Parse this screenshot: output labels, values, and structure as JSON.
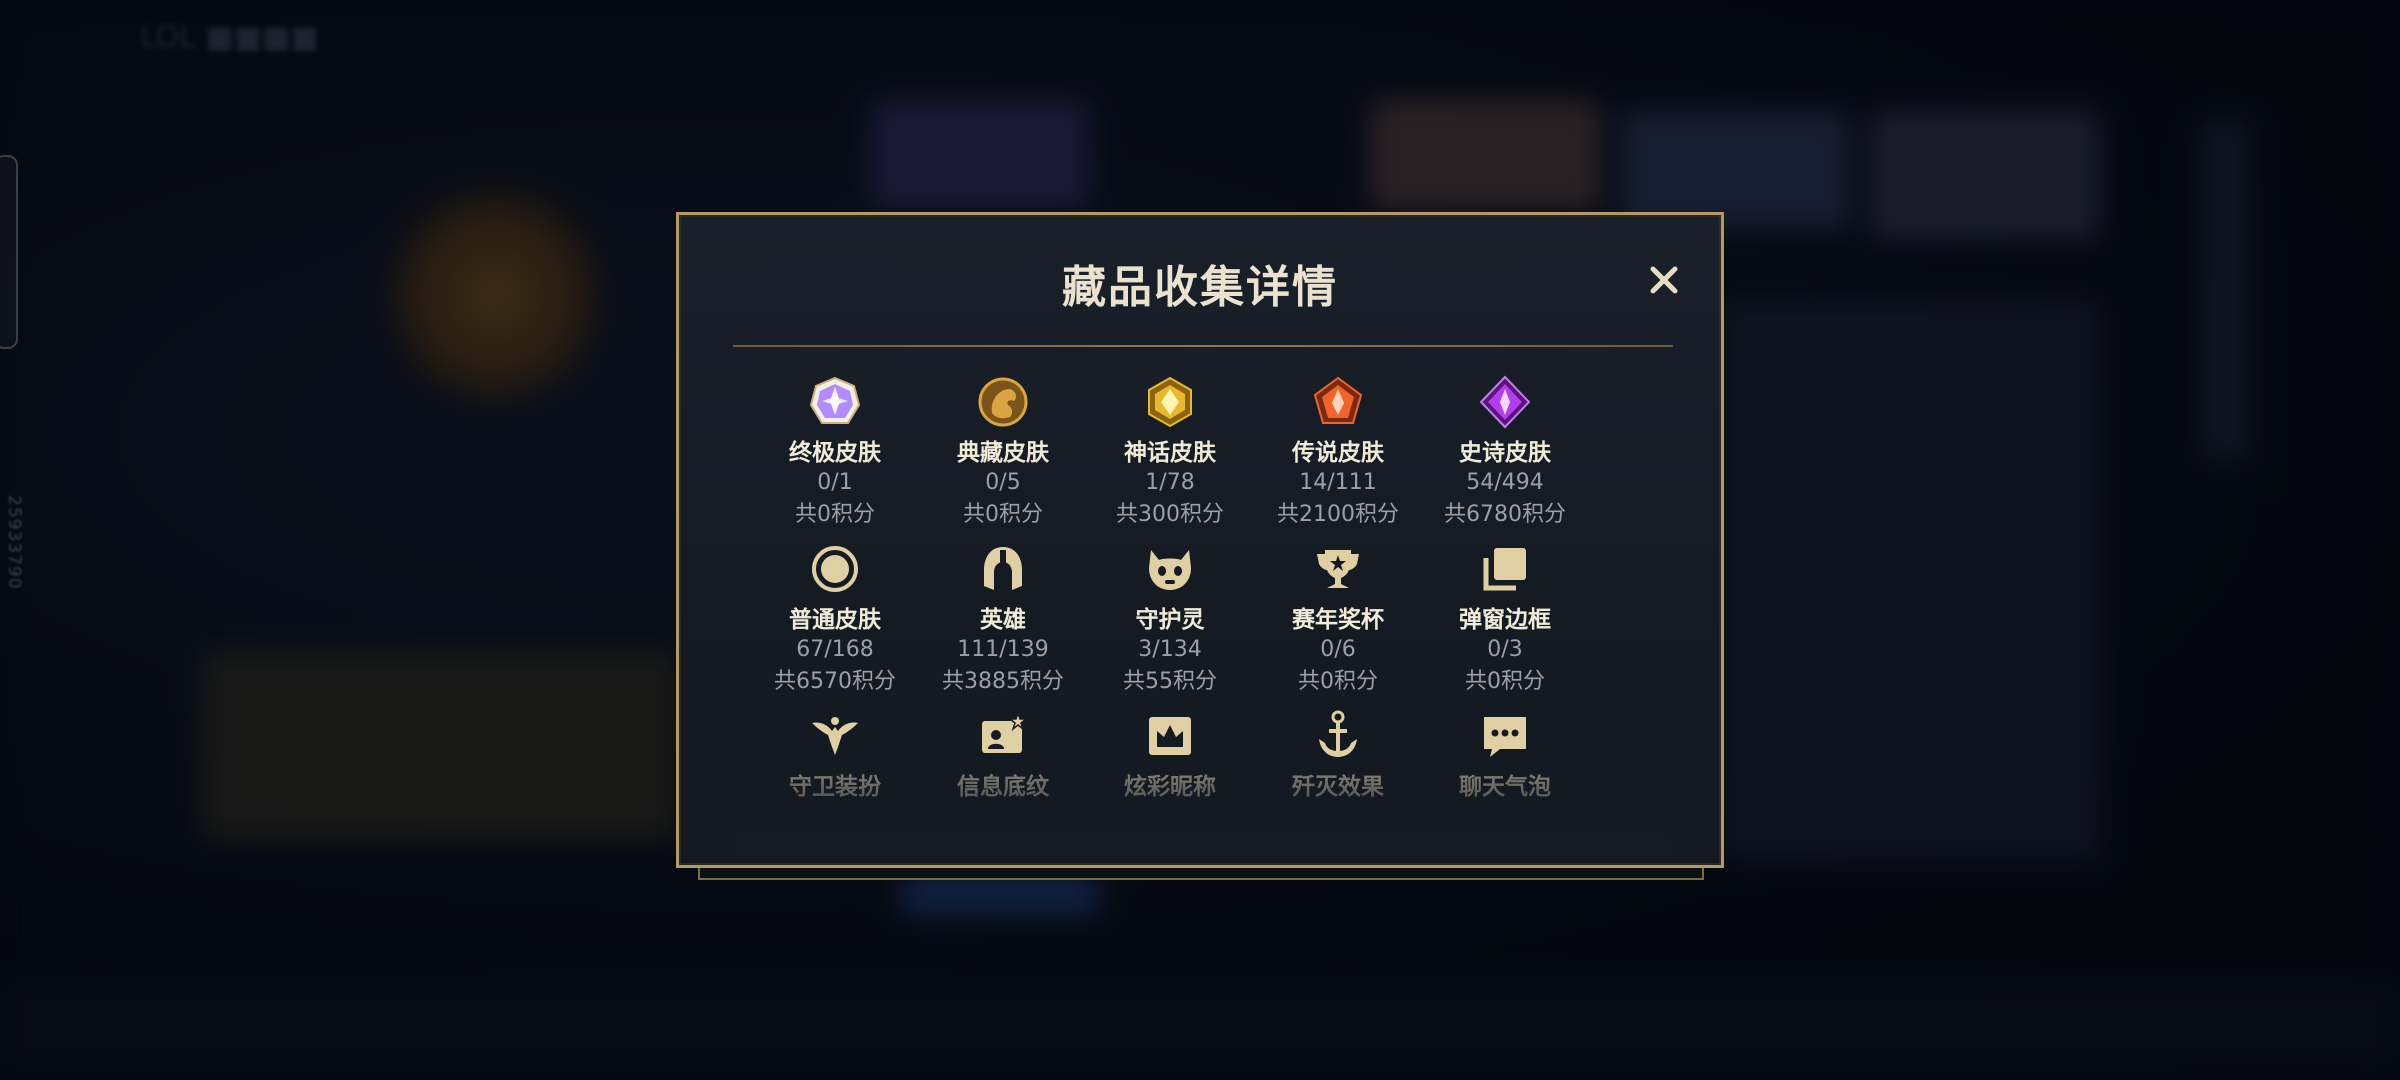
{
  "modal": {
    "title": "藏品收集详情",
    "close_icon": "close-icon"
  },
  "side_id": "25933790",
  "categories": [
    {
      "name": "终极皮肤",
      "count": "0/1",
      "points": "共0积分",
      "icon": "ultimate-skin-icon",
      "color": "#b28cff"
    },
    {
      "name": "典藏皮肤",
      "count": "0/5",
      "points": "共0积分",
      "icon": "prestige-skin-icon",
      "color": "#d9a441"
    },
    {
      "name": "神话皮肤",
      "count": "1/78",
      "points": "共300积分",
      "icon": "mythic-skin-icon",
      "color": "#e8b92c"
    },
    {
      "name": "传说皮肤",
      "count": "14/111",
      "points": "共2100积分",
      "icon": "legendary-skin-icon",
      "color": "#f0642a"
    },
    {
      "name": "史诗皮肤",
      "count": "54/494",
      "points": "共6780积分",
      "icon": "epic-skin-icon",
      "color": "#b33df0"
    },
    {
      "name": "普通皮肤",
      "count": "67/168",
      "points": "共6570积分",
      "icon": "common-skin-icon",
      "color": "#d9d3c3"
    },
    {
      "name": "英雄",
      "count": "111/139",
      "points": "共3885积分",
      "icon": "champion-helmet-icon",
      "color": "#d9d3c3"
    },
    {
      "name": "守护灵",
      "count": "3/134",
      "points": "共55积分",
      "icon": "guardian-spirit-icon",
      "color": "#d9d3c3"
    },
    {
      "name": "赛年奖杯",
      "count": "0/6",
      "points": "共0积分",
      "icon": "season-trophy-icon",
      "color": "#d9d3c3"
    },
    {
      "name": "弹窗边框",
      "count": "0/3",
      "points": "共0积分",
      "icon": "popup-frame-icon",
      "color": "#d9d3c3"
    },
    {
      "name": "守卫装扮",
      "count": "",
      "points": "",
      "icon": "ward-skin-icon",
      "color": "#d9d3c3"
    },
    {
      "name": "信息底纹",
      "count": "",
      "points": "",
      "icon": "info-banner-icon",
      "color": "#d9d3c3"
    },
    {
      "name": "炫彩昵称",
      "count": "",
      "points": "",
      "icon": "chroma-name-icon",
      "color": "#d9d3c3"
    },
    {
      "name": "歼灭效果",
      "count": "",
      "points": "",
      "icon": "annihilation-effect-icon",
      "color": "#d9d3c3"
    },
    {
      "name": "聊天气泡",
      "count": "",
      "points": "",
      "icon": "chat-bubble-icon",
      "color": "#d9d3c3"
    }
  ]
}
